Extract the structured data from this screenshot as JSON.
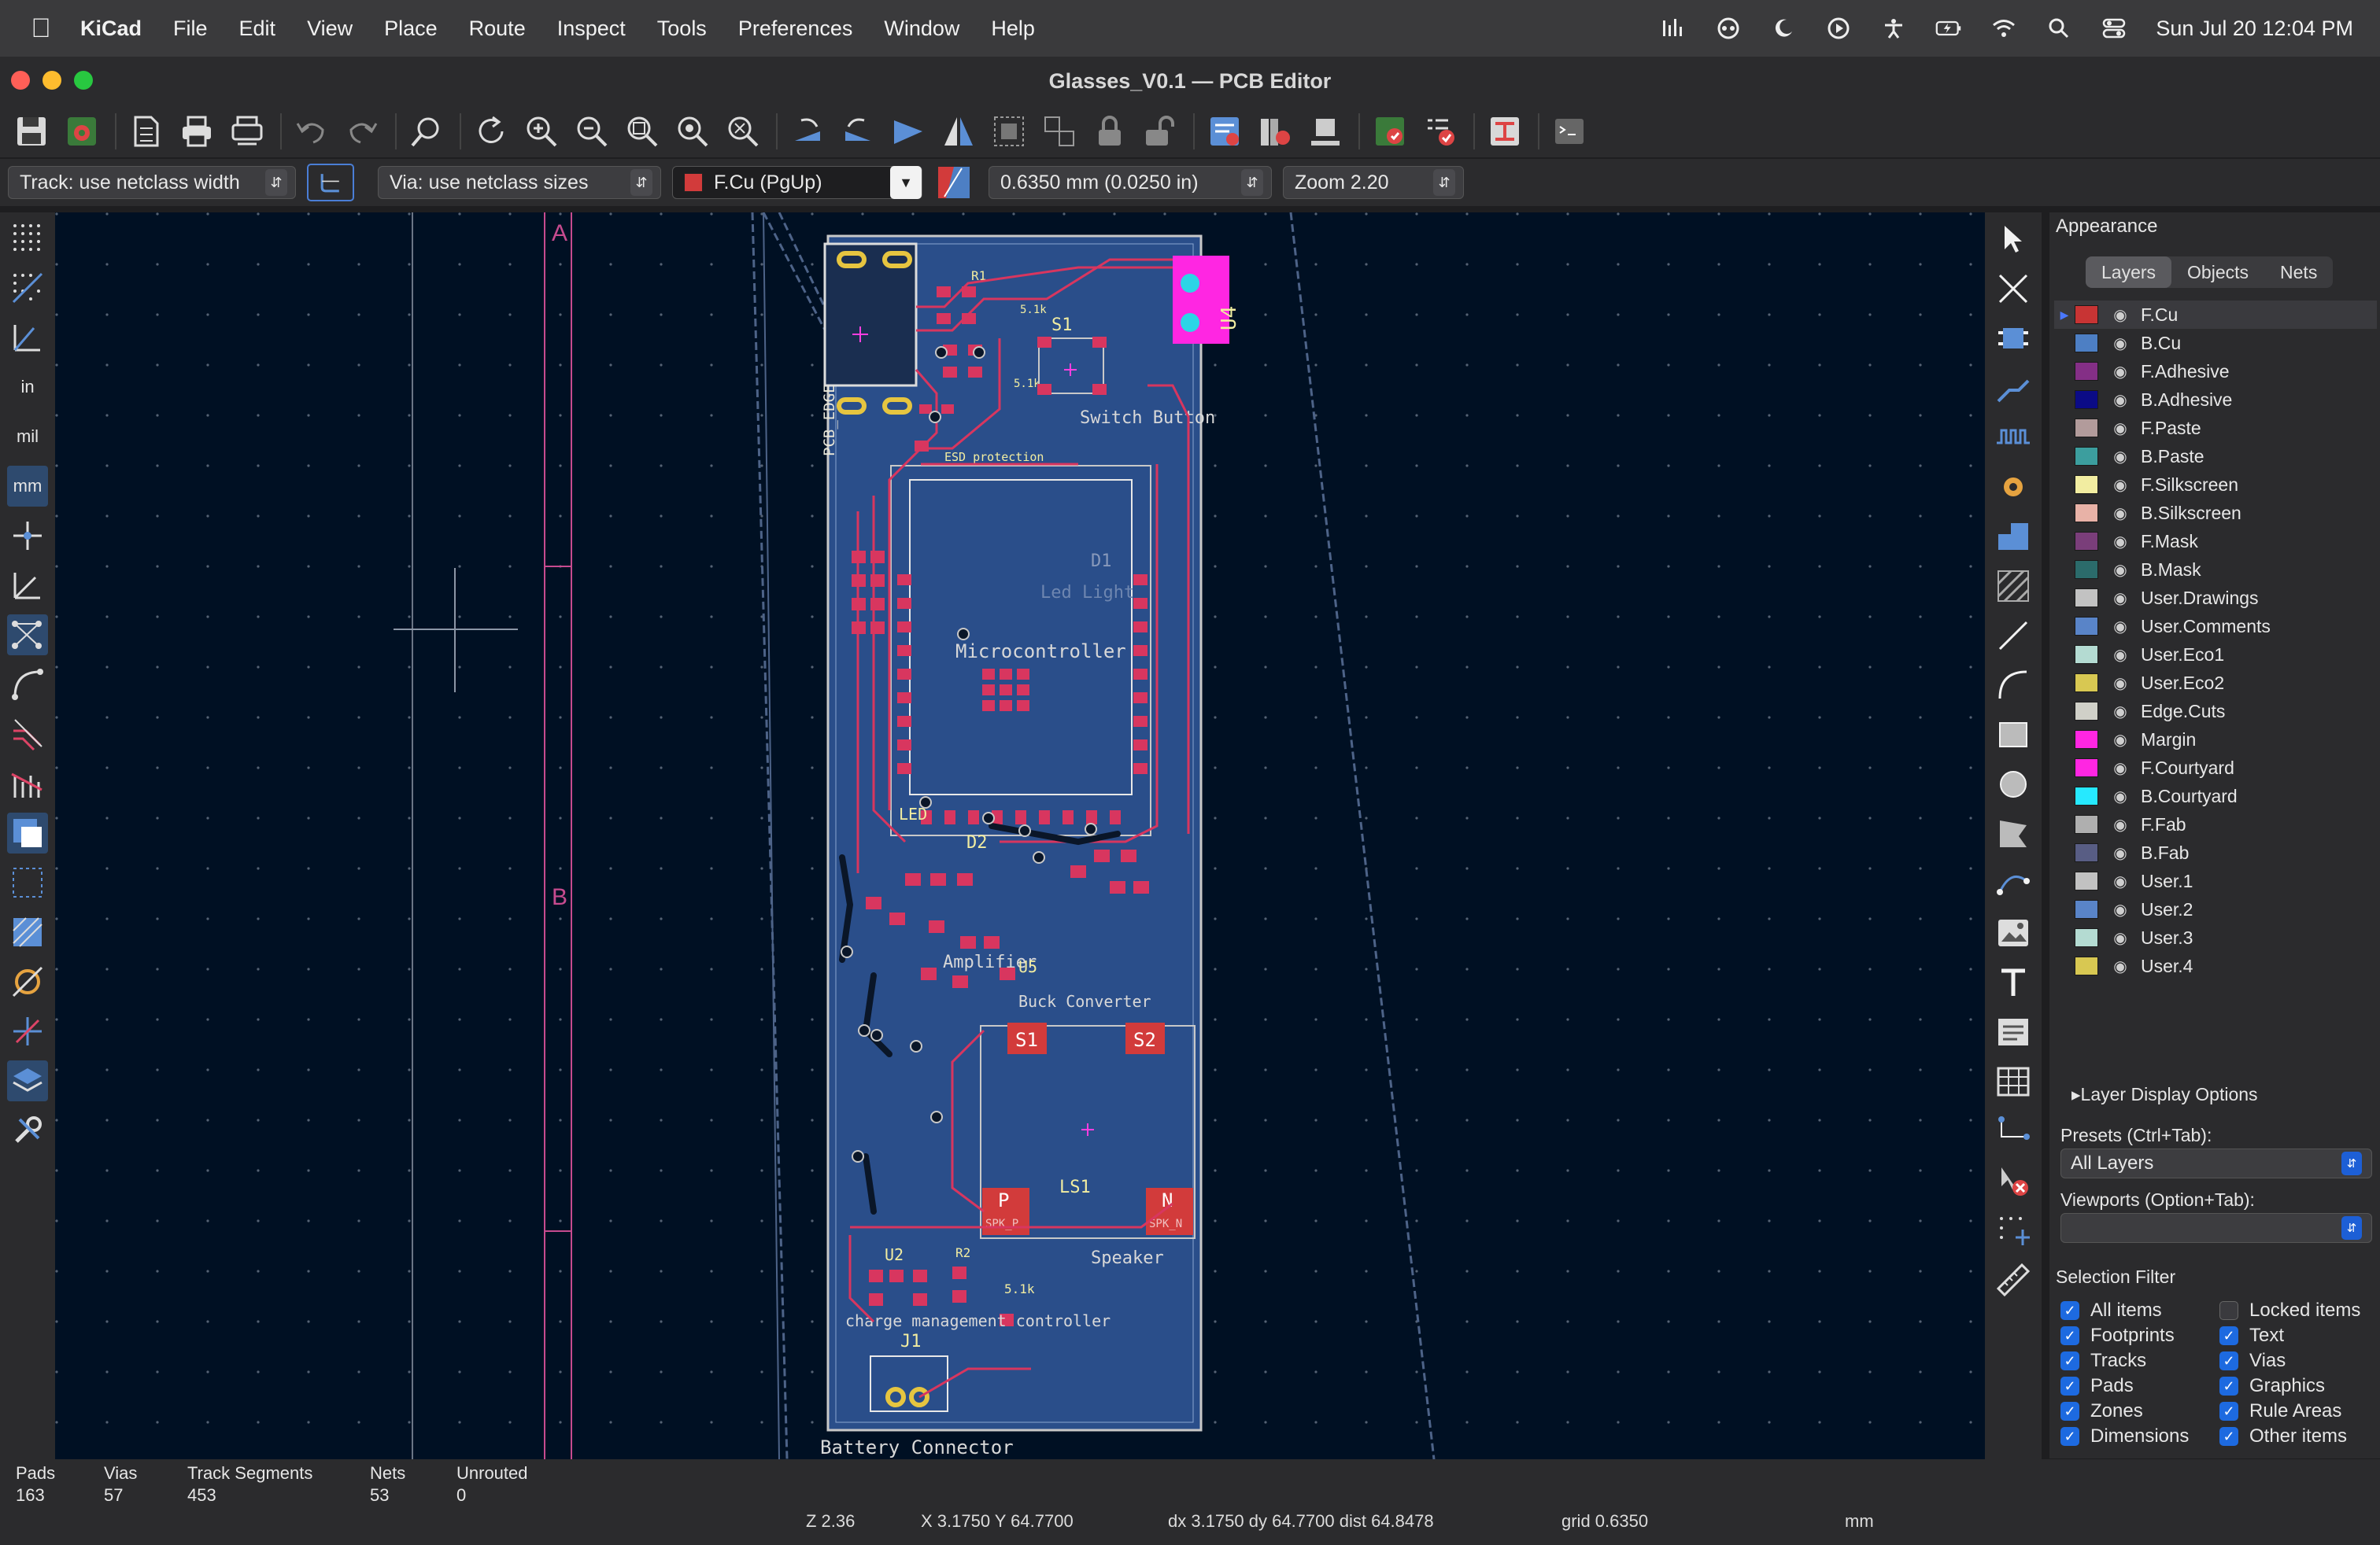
{
  "menubar": {
    "app_name": "KiCad",
    "items": [
      "File",
      "Edit",
      "View",
      "Place",
      "Route",
      "Inspect",
      "Tools",
      "Preferences",
      "Window",
      "Help"
    ],
    "clock": "Sun Jul 20  12:04 PM"
  },
  "window": {
    "title": "Glasses_V0.1 — PCB Editor"
  },
  "toolbar2": {
    "track": "Track: use netclass width",
    "via": "Via: use netclass sizes",
    "layer": "F.Cu (PgUp)",
    "grid": "0.6350 mm (0.0250 in)",
    "zoom": "Zoom 2.20"
  },
  "lefttools": {
    "unit_in": "in",
    "unit_mil": "mil",
    "unit_mm": "mm"
  },
  "board": {
    "labels": {
      "col_a": "A",
      "col_b": "B",
      "pcb_edge": "PCB_EDGE",
      "esd": "ESD protection",
      "r1": "R1",
      "s1": "S1",
      "switch_button": "Switch Button",
      "u4": "U4",
      "d1": "D1",
      "led_light": "Led Light",
      "microcontroller": "Microcontroller",
      "led": "LED",
      "d2": "D2",
      "amplifier": "Amplifier",
      "u5": "U5",
      "buck": "Buck Converter",
      "pad_s1": "S1",
      "pad_s2": "S2",
      "ls1": "LS1",
      "pad_p": "P",
      "spk_p": "SPK_P",
      "pad_n": "N",
      "spk_n": "SPK_N",
      "speaker": "Speaker",
      "u2": "U2",
      "r2": "R2",
      "r2_val": "5.1k",
      "charge": "charge management controller",
      "j1": "J1",
      "battery": "Battery Connector",
      "val_51k_a": "5.1k",
      "val_51k_b": "5.1k"
    }
  },
  "appearance": {
    "title": "Appearance",
    "tabs": [
      "Layers",
      "Objects",
      "Nets"
    ],
    "layers": [
      {
        "name": "F.Cu",
        "color": "#c83434"
      },
      {
        "name": "B.Cu",
        "color": "#4d7fc4"
      },
      {
        "name": "F.Adhesive",
        "color": "#842f86"
      },
      {
        "name": "B.Adhesive",
        "color": "#0b0b86"
      },
      {
        "name": "F.Paste",
        "color": "#b29b9b"
      },
      {
        "name": "B.Paste",
        "color": "#3c9e9e"
      },
      {
        "name": "F.Silkscreen",
        "color": "#f2eda1"
      },
      {
        "name": "B.Silkscreen",
        "color": "#e8b2a7"
      },
      {
        "name": "F.Mask",
        "color": "#7a3e7a"
      },
      {
        "name": "B.Mask",
        "color": "#2b6b6b"
      },
      {
        "name": "User.Drawings",
        "color": "#c2c2c2"
      },
      {
        "name": "User.Comments",
        "color": "#5984c8"
      },
      {
        "name": "User.Eco1",
        "color": "#b4dbd2"
      },
      {
        "name": "User.Eco2",
        "color": "#d8c852"
      },
      {
        "name": "Edge.Cuts",
        "color": "#d0d0c8"
      },
      {
        "name": "Margin",
        "color": "#ff26e2"
      },
      {
        "name": "F.Courtyard",
        "color": "#ff26e2"
      },
      {
        "name": "B.Courtyard",
        "color": "#26e9ff"
      },
      {
        "name": "F.Fab",
        "color": "#afafaf"
      },
      {
        "name": "B.Fab",
        "color": "#585d84"
      },
      {
        "name": "User.1",
        "color": "#c2c2c2"
      },
      {
        "name": "User.2",
        "color": "#5984c8"
      },
      {
        "name": "User.3",
        "color": "#b4dbd2"
      },
      {
        "name": "User.4",
        "color": "#d8c852"
      }
    ],
    "layer_display_options": "Layer Display Options",
    "presets_label": "Presets (Ctrl+Tab):",
    "presets_value": "All Layers",
    "viewports_label": "Viewports (Option+Tab):",
    "viewports_value": ""
  },
  "selection_filter": {
    "title": "Selection Filter",
    "items": [
      {
        "label": "All items",
        "checked": true
      },
      {
        "label": "Locked items",
        "checked": false
      },
      {
        "label": "Footprints",
        "checked": true
      },
      {
        "label": "Text",
        "checked": true
      },
      {
        "label": "Tracks",
        "checked": true
      },
      {
        "label": "Vias",
        "checked": true
      },
      {
        "label": "Pads",
        "checked": true
      },
      {
        "label": "Graphics",
        "checked": true
      },
      {
        "label": "Zones",
        "checked": true
      },
      {
        "label": "Rule Areas",
        "checked": true
      },
      {
        "label": "Dimensions",
        "checked": true
      },
      {
        "label": "Other items",
        "checked": true
      }
    ]
  },
  "status": {
    "pads_label": "Pads",
    "pads": "163",
    "vias_label": "Vias",
    "vias": "57",
    "tracks_label": "Track Segments",
    "tracks": "453",
    "nets_label": "Nets",
    "nets": "53",
    "unrouted_label": "Unrouted",
    "unrouted": "0",
    "zoom": "Z 2.36",
    "xy": "X 3.1750  Y 64.7700",
    "dxy": "dx 3.1750  dy 64.7700  dist 64.8478",
    "grid": "grid 0.6350",
    "units": "mm"
  }
}
